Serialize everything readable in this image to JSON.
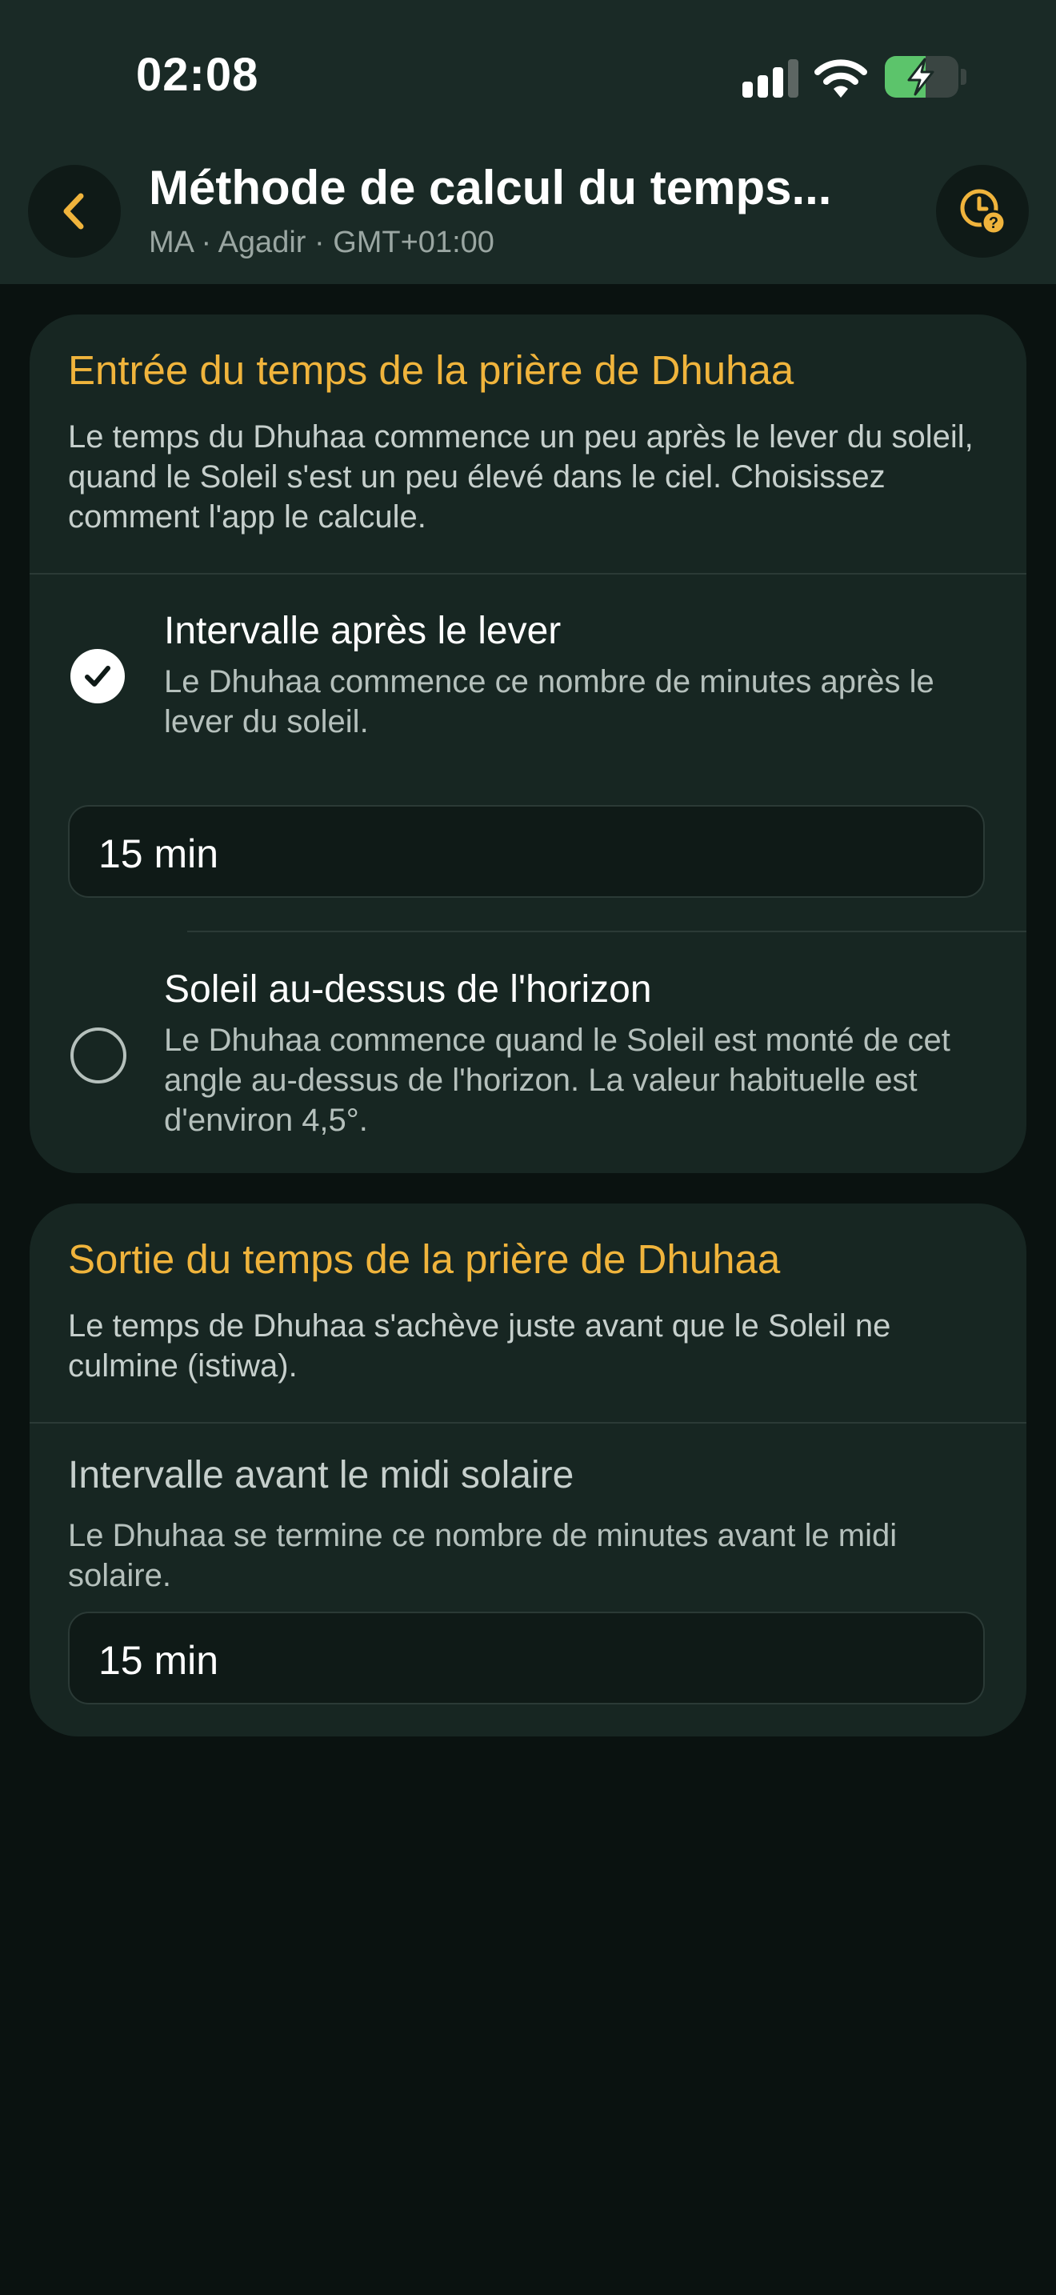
{
  "status_bar": {
    "time": "02:08"
  },
  "header": {
    "title": "Méthode de calcul du temps...",
    "subtitle": "MA · Agadir · GMT+01:00",
    "back_icon": "chevron-left-icon",
    "action_icon": "clock-question-icon"
  },
  "entry_card": {
    "title": "Entrée du temps de la prière de Dhuhaa",
    "description": "Le temps du Dhuhaa commence un peu après le lever du soleil, quand le Soleil s'est un peu élevé dans le ciel. Choisissez comment l'app le calcule.",
    "options": [
      {
        "title": "Intervalle après le lever",
        "description": "Le Dhuhaa commence ce nombre de minutes après le lever du soleil.",
        "selected": true,
        "value": "15 min"
      },
      {
        "title": "Soleil au-dessus de l'horizon",
        "description": "Le Dhuhaa commence quand le Soleil est monté de cet angle au-dessus de l'horizon. La valeur habituelle est d'environ 4,5°.",
        "selected": false
      }
    ]
  },
  "exit_card": {
    "title": "Sortie du temps de la prière de Dhuhaa",
    "description": "Le temps de Dhuhaa s'achève juste avant que le Soleil ne culmine (istiwa).",
    "setting": {
      "title": "Intervalle avant le midi solaire",
      "description": "Le Dhuhaa se termine ce nombre de minutes avant le midi solaire.",
      "value": "15 min"
    }
  },
  "colors": {
    "accent": "#f0b43c",
    "background": "#0a1210",
    "card": "#172622",
    "battery_charging": "#5cc46b"
  },
  "battery_level": 0.55
}
